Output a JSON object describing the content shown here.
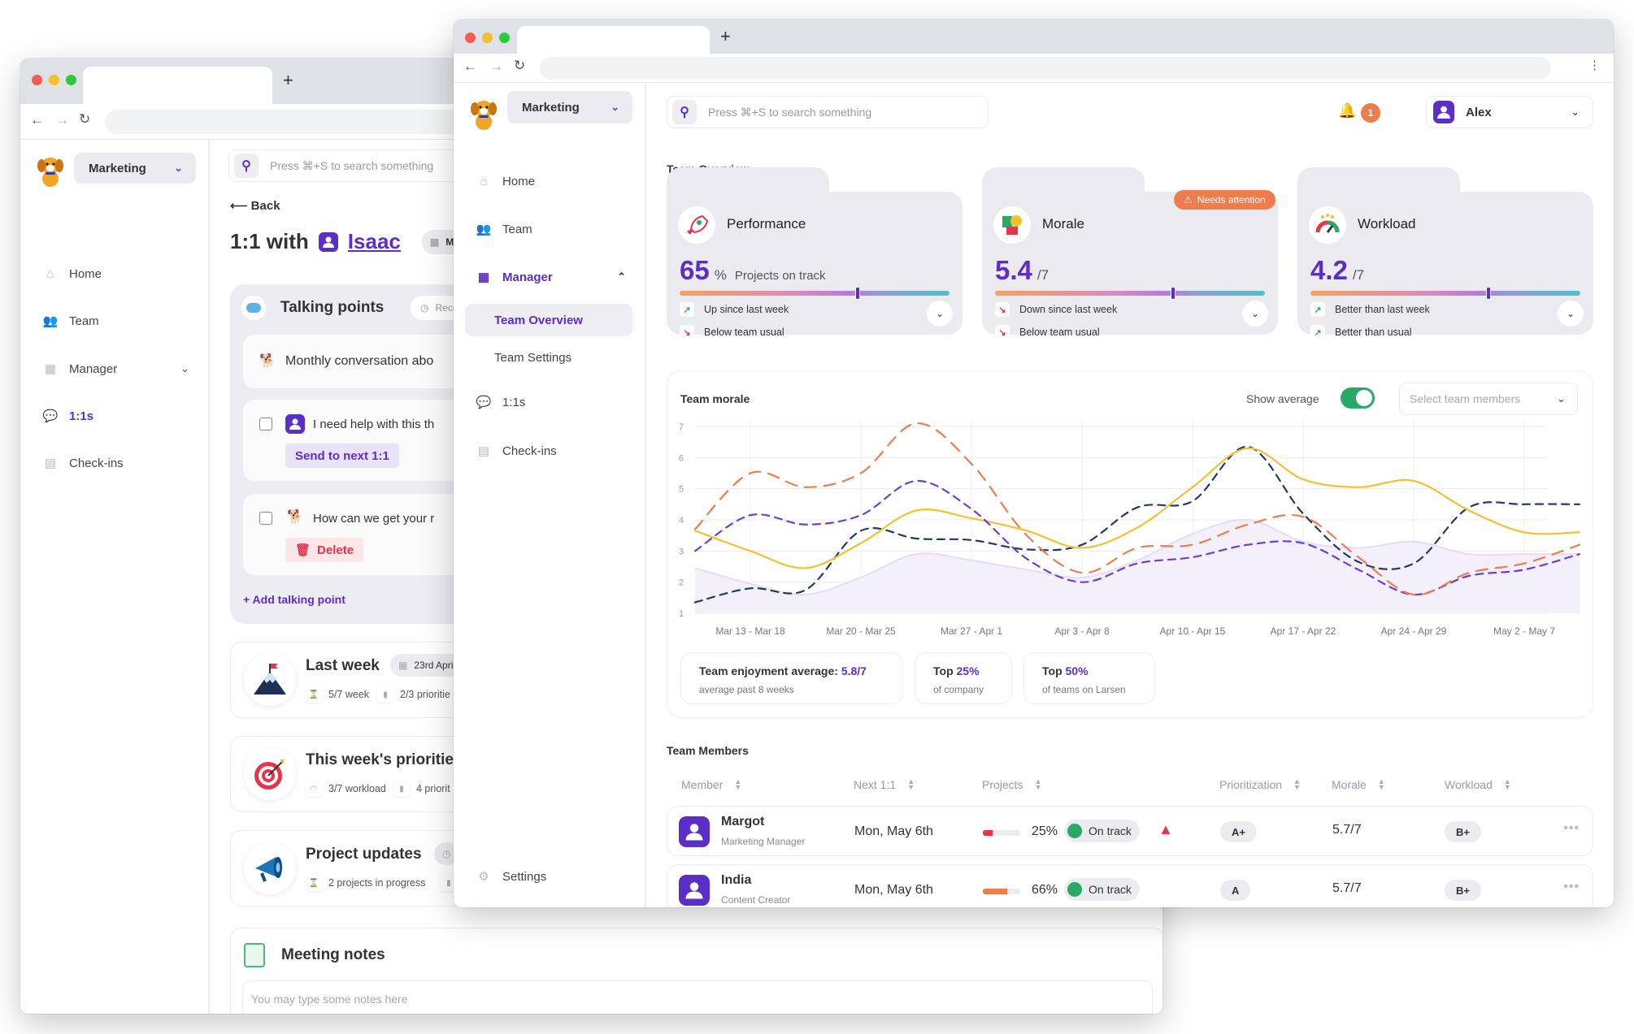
{
  "back_window": {
    "sidebar": {
      "org": "Marketing",
      "items": [
        {
          "label": "Home",
          "icon": "home-icon"
        },
        {
          "label": "Team",
          "icon": "team-icon"
        },
        {
          "label": "Manager",
          "icon": "presentation-icon"
        },
        {
          "label": "1:1s",
          "icon": "chat-icon",
          "active": true
        },
        {
          "label": "Check-ins",
          "icon": "document-icon"
        }
      ]
    },
    "search_placeholder": "Press ⌘+S to search something",
    "back_label": "Back",
    "title_prefix": "1:1 with",
    "person": "Isaac",
    "date_chip": "Mon, M",
    "talking_points": {
      "title": "Talking points",
      "badge": "Recomm",
      "items": [
        {
          "text": "Monthly conversation abo"
        },
        {
          "text": "I need help with this th",
          "action": "Send to next 1:1"
        },
        {
          "text": "How can we get your r",
          "action": "Delete"
        }
      ],
      "add_label": "Add talking point"
    },
    "sections": [
      {
        "title": "Last week",
        "chip": "23rd Apri",
        "stats": [
          "5/7 week",
          "2/3 prioritie"
        ]
      },
      {
        "title": "This week's priorities",
        "chip": "",
        "stats": [
          "3/7 workload",
          "4 priorit"
        ]
      },
      {
        "title": "Project updates",
        "chip": "",
        "stats": [
          "2 projects in progress",
          ""
        ]
      }
    ],
    "notes": {
      "title": "Meeting notes",
      "placeholder": "You may type some notes here"
    }
  },
  "front_window": {
    "sidebar": {
      "org": "Marketing",
      "items": [
        {
          "label": "Home"
        },
        {
          "label": "Team"
        },
        {
          "label": "Manager"
        },
        {
          "label": "Team Overview"
        },
        {
          "label": "Team Settings"
        },
        {
          "label": "1:1s"
        },
        {
          "label": "Check-ins"
        }
      ],
      "settings": "Settings"
    },
    "search_placeholder": "Press ⌘+S to search something",
    "notifications_count": "1",
    "user": "Alex",
    "section_title": "Team Overview",
    "metrics": [
      {
        "title": "Performance",
        "value": "65",
        "unit": "%",
        "sub": "Projects on track",
        "position": 0.66,
        "trends": [
          {
            "dir": "up",
            "text": "Up since last week"
          },
          {
            "dir": "down",
            "text": "Below team usual"
          }
        ]
      },
      {
        "title": "Morale",
        "value": "5.4",
        "unit": "/7",
        "sub": "",
        "position": 0.66,
        "badge": "Needs attention",
        "trends": [
          {
            "dir": "down",
            "text": "Down since last week"
          },
          {
            "dir": "down",
            "text": "Below team usual"
          }
        ]
      },
      {
        "title": "Workload",
        "value": "4.2",
        "unit": "/7",
        "sub": "",
        "position": 0.66,
        "trends": [
          {
            "dir": "up",
            "text": "Better than last week"
          },
          {
            "dir": "up",
            "text": "Better than usual"
          }
        ]
      }
    ],
    "morale_card": {
      "title": "Team morale",
      "show_average_label": "Show average",
      "show_average_on": true,
      "select_placeholder": "Select team members",
      "stats": [
        {
          "label": "Team enjoyment average: ",
          "value": "5.8/7",
          "sub": "average past 8 weeks"
        },
        {
          "label": "Top ",
          "value": "25%",
          "sub": "of company"
        },
        {
          "label": "Top ",
          "value": "50%",
          "sub": "of teams on Larsen"
        }
      ]
    },
    "members": {
      "title": "Team Members",
      "columns": [
        "Member",
        "Next 1:1",
        "Projects",
        "Prioritization",
        "Morale",
        "Workload"
      ],
      "rows": [
        {
          "name": "Margot",
          "role": "Marketing Manager",
          "next": "Mon, May 6th",
          "projects_pct": "25%",
          "projects_fill": 0.25,
          "bar_color": "#e8334a",
          "status": "On track",
          "warning": true,
          "prioritization": "A+",
          "morale": "5.7/7",
          "workload": "B+"
        },
        {
          "name": "India",
          "role": "Content Creator",
          "next": "Mon, May 6th",
          "projects_pct": "66%",
          "projects_fill": 0.66,
          "bar_color": "#ee7d4e",
          "status": "On track",
          "warning": false,
          "prioritization": "A",
          "morale": "5.7/7",
          "workload": "B+"
        }
      ]
    }
  },
  "colors": {
    "accent": "#5b2ec9",
    "orange": "#ee7d4e",
    "green": "#2aa866",
    "red": "#e8334a",
    "yellow": "#f5c02e",
    "navy": "#1f3b63"
  },
  "chart_data": {
    "type": "line",
    "title": "Team morale",
    "categories": [
      "Mar 13 - Mar 18",
      "Mar 20 - Mar 25",
      "Mar 27 - Apr 1",
      "Apr 3 - Apr 8",
      "Apr 10 - Apr 15",
      "Apr 17 - Apr 22",
      "Apr 24 - Apr 29",
      "May 2 - May 7"
    ],
    "x": [
      -0.5,
      0,
      0.5,
      1,
      1.5,
      2,
      2.5,
      3,
      3.5,
      4,
      4.5,
      5,
      5.5,
      6,
      6.5,
      7,
      7.5
    ],
    "ylim": [
      1,
      7
    ],
    "yticks": [
      1,
      2,
      3,
      4,
      5,
      6,
      7
    ],
    "grid": true,
    "series": [
      {
        "name": "orange-dashed",
        "color": "#ee7d4e",
        "dash": "long",
        "values": [
          3.7,
          5.5,
          5.05,
          5.5,
          7.1,
          5.8,
          3.5,
          2.3,
          3.1,
          3.2,
          3.85,
          4.1,
          2.8,
          1.6,
          2.3,
          2.6,
          3.2
        ]
      },
      {
        "name": "purple-dashed",
        "color": "#6b3fd6",
        "dash": "medium",
        "values": [
          3.0,
          4.15,
          3.85,
          4.15,
          5.25,
          4.35,
          2.75,
          2.0,
          2.6,
          2.8,
          3.2,
          3.25,
          2.4,
          1.6,
          2.2,
          2.4,
          2.9
        ]
      },
      {
        "name": "yellow-solid",
        "color": "#f5c02e",
        "dash": "none",
        "values": [
          3.65,
          3.0,
          2.45,
          3.25,
          4.3,
          4.05,
          3.65,
          3.1,
          3.75,
          5.05,
          6.3,
          5.3,
          5.05,
          5.25,
          4.3,
          3.6,
          3.6
        ]
      },
      {
        "name": "navy-dashed",
        "color": "#1f3b63",
        "dash": "medium",
        "values": [
          1.35,
          1.8,
          1.75,
          3.65,
          3.4,
          3.35,
          3.05,
          3.2,
          4.4,
          4.6,
          6.35,
          4.2,
          2.65,
          2.6,
          4.4,
          4.5,
          4.5
        ]
      },
      {
        "name": "average-area",
        "color": "#e5dcf7",
        "dash": "area",
        "values": [
          2.45,
          1.95,
          1.6,
          2.15,
          2.9,
          2.7,
          2.4,
          2.15,
          2.7,
          3.55,
          4.0,
          3.3,
          3.1,
          3.3,
          2.9,
          2.9,
          2.9
        ]
      }
    ]
  }
}
